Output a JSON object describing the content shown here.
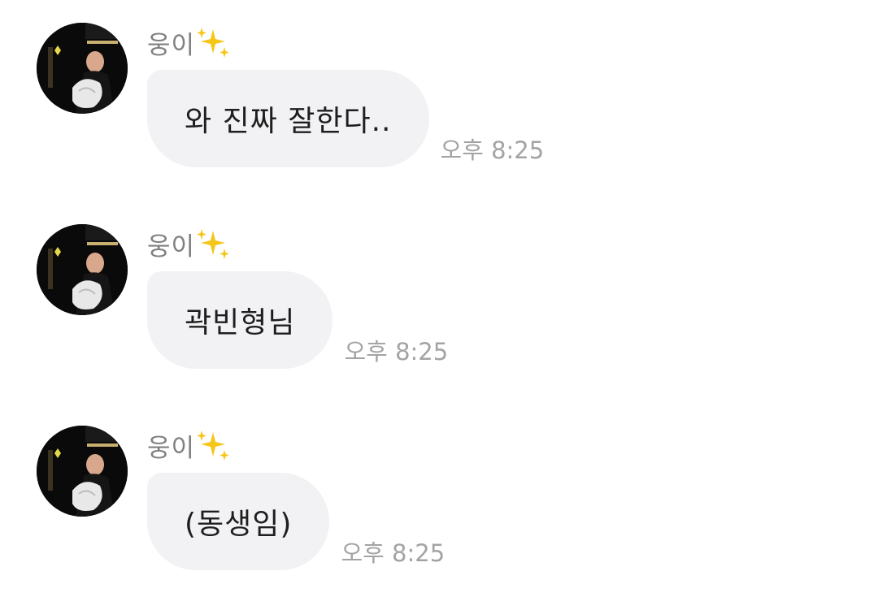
{
  "messages": [
    {
      "sender": "웅이",
      "text": "와 진짜 잘한다..",
      "time": "오후 8:25",
      "avatar_icon": "profile-photo",
      "name_emoji": "sparkles"
    },
    {
      "sender": "웅이",
      "text": "곽빈형님",
      "time": "오후 8:25",
      "avatar_icon": "profile-photo",
      "name_emoji": "sparkles"
    },
    {
      "sender": "웅이",
      "text": "(동생임)",
      "time": "오후 8:25",
      "avatar_icon": "profile-photo",
      "name_emoji": "sparkles"
    }
  ],
  "colors": {
    "background": "#ffffff",
    "bubble": "#f2f2f4",
    "sender_name": "#808080",
    "timestamp": "#a3a3a3",
    "message_text": "#1e1e1e",
    "sparkle": "#f5c518"
  }
}
